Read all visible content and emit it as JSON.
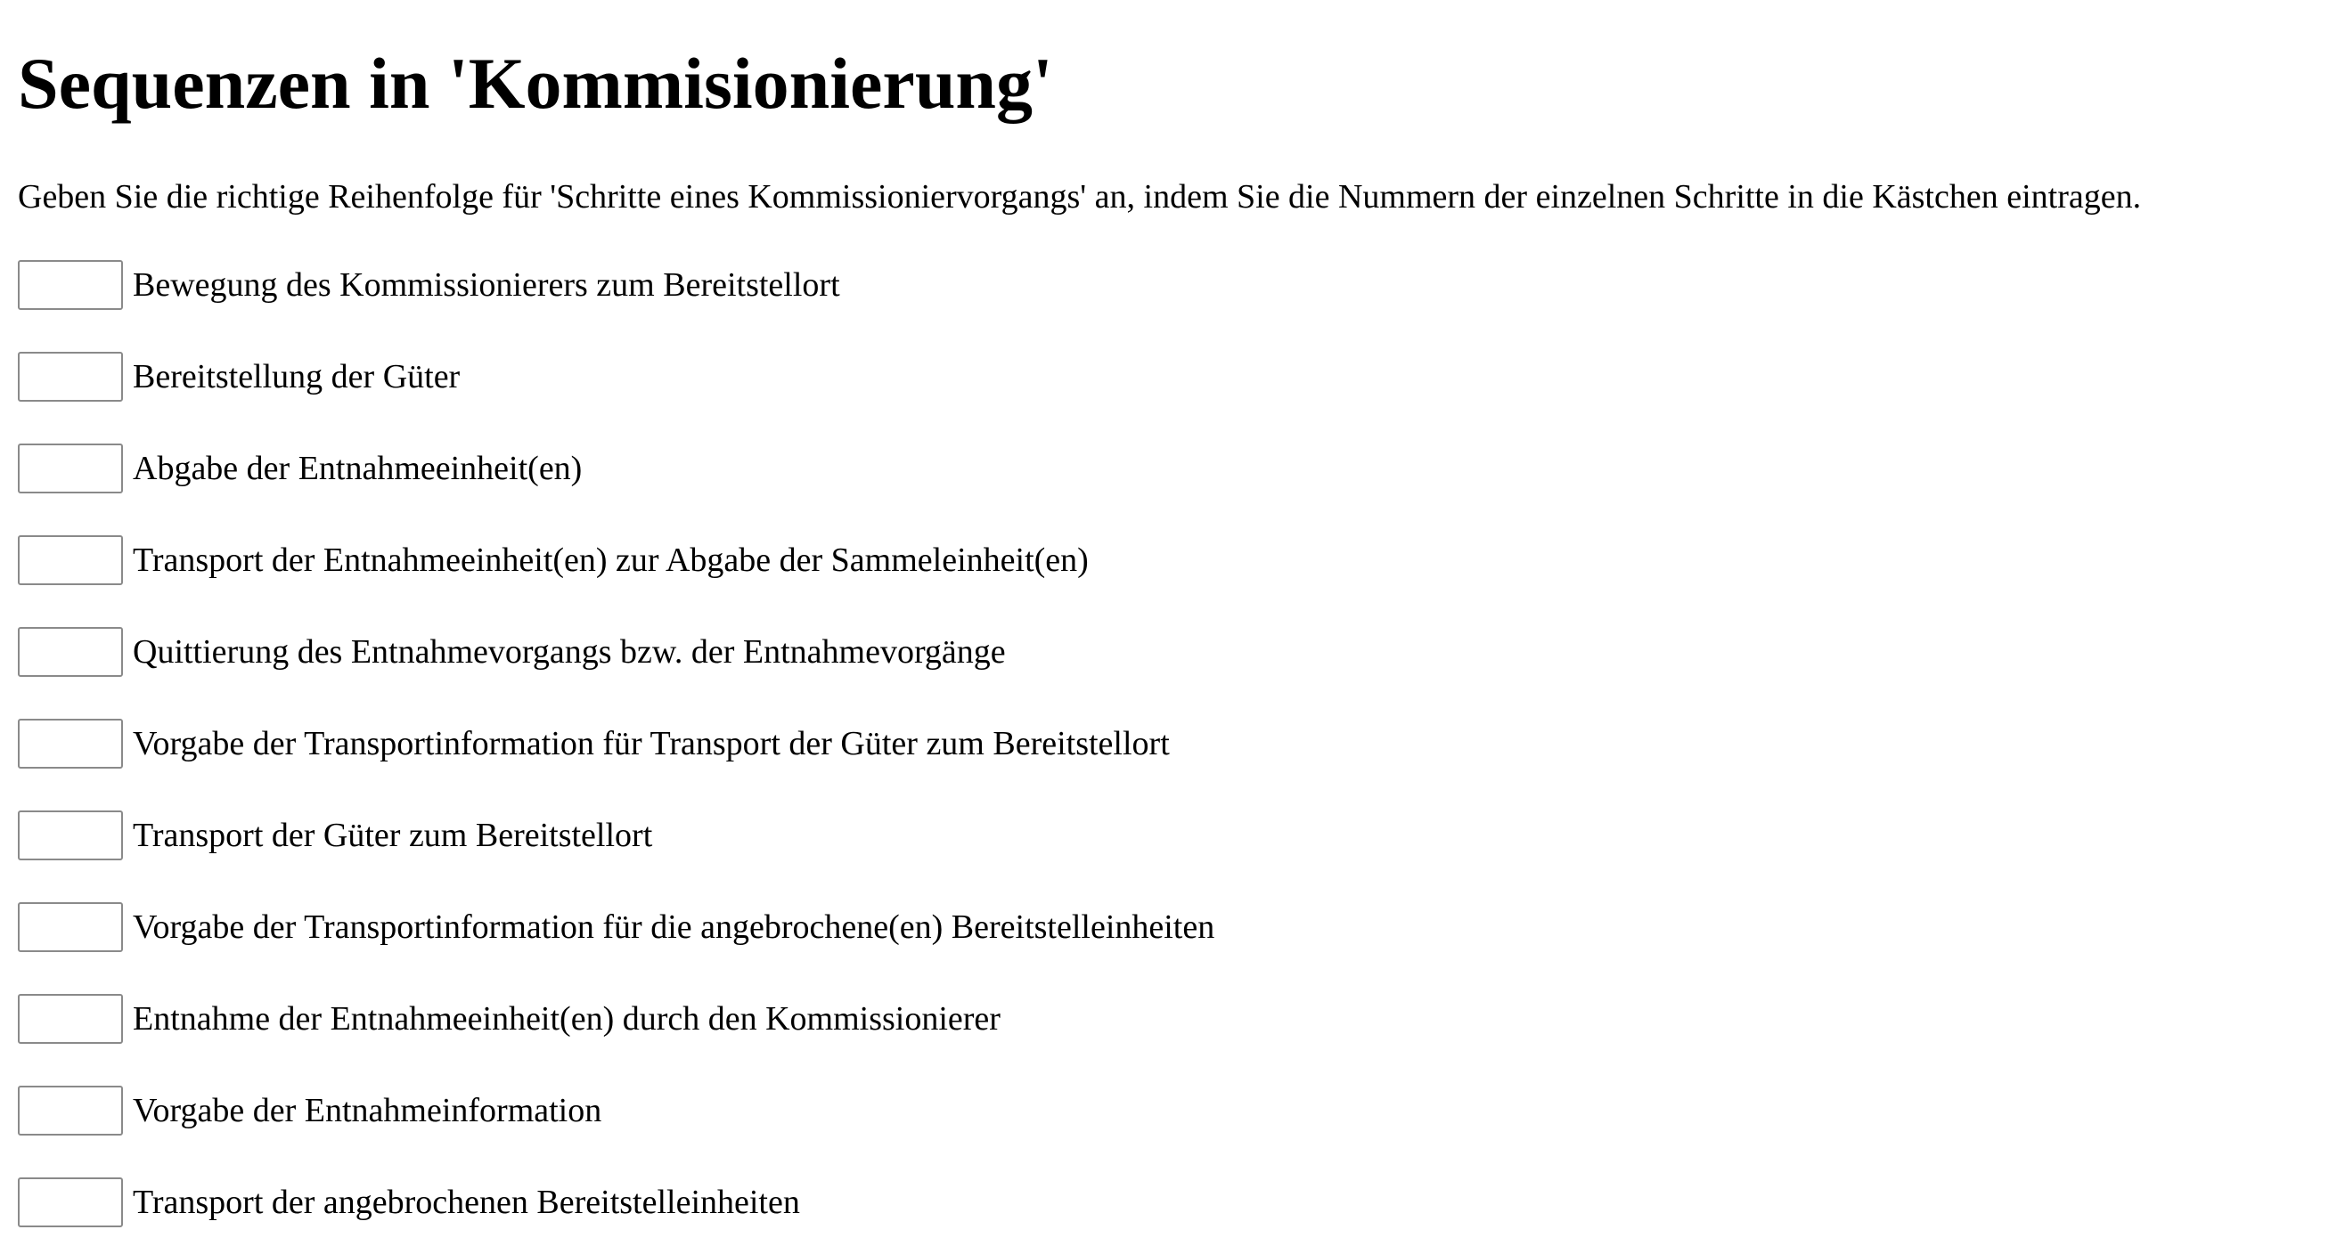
{
  "page": {
    "title": "Sequenzen in 'Kommisionierung'",
    "instruction": "Geben Sie die richtige Reihenfolge für 'Schritte eines Kommissioniervorgangs' an, indem Sie die Nummern der einzelnen Schritte in die Kästchen eintragen."
  },
  "steps": [
    {
      "label": "Bewegung des Kommissionierers zum Bereitstellort",
      "value": ""
    },
    {
      "label": "Bereitstellung der Güter",
      "value": ""
    },
    {
      "label": "Abgabe der Entnahmeeinheit(en)",
      "value": ""
    },
    {
      "label": "Transport der Entnahmeeinheit(en) zur Abgabe der Sammeleinheit(en)",
      "value": ""
    },
    {
      "label": "Quittierung des Entnahmevorgangs bzw. der Entnahmevorgänge",
      "value": ""
    },
    {
      "label": "Vorgabe der Transportinformation für Transport der Güter zum Bereitstellort",
      "value": ""
    },
    {
      "label": "Transport der Güter zum Bereitstellort",
      "value": ""
    },
    {
      "label": "Vorgabe der Transportinformation für die angebrochene(en) Bereitstelleinheiten",
      "value": ""
    },
    {
      "label": "Entnahme der Entnahmeeinheit(en) durch den Kommissionierer",
      "value": ""
    },
    {
      "label": "Vorgabe der Entnahmeinformation",
      "value": ""
    },
    {
      "label": "Transport der angebrochenen Bereitstelleinheiten",
      "value": ""
    }
  ]
}
